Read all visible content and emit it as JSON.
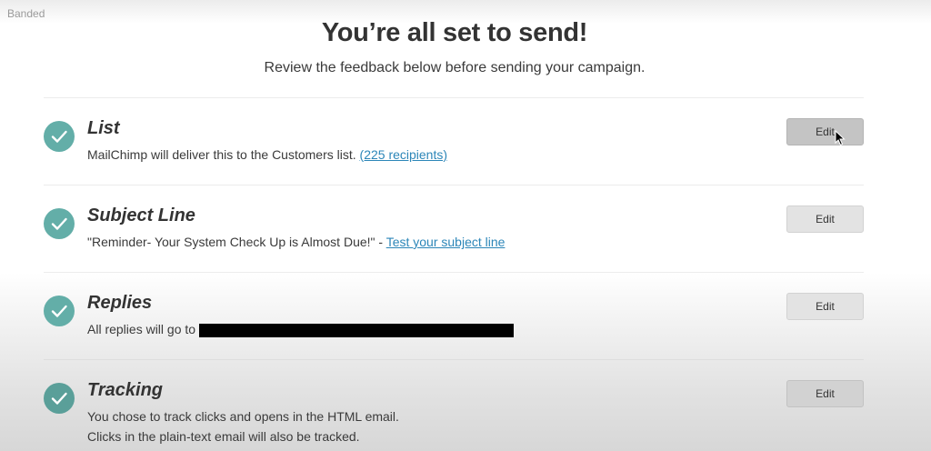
{
  "watermark": "Banded",
  "header": {
    "title": "You’re all set to send!",
    "subtitle": "Review the feedback below before sending your campaign."
  },
  "sections": [
    {
      "title": "List",
      "text": "MailChimp will deliver this to the Customers list.",
      "link": "(225 recipients)",
      "edit_label": "Edit"
    },
    {
      "title": "Subject Line",
      "text": "\"Reminder- Your System Check Up is Almost Due!\" -",
      "link": "Test your subject line",
      "edit_label": "Edit"
    },
    {
      "title": "Replies",
      "text": "All replies will go to",
      "edit_label": "Edit"
    },
    {
      "title": "Tracking",
      "text": "You chose to track clicks and opens in the HTML email.",
      "text2": "Clicks in the plain-text email will also be tracked.",
      "edit_label": "Edit"
    }
  ],
  "icons": {
    "check": "check-icon",
    "cursor": "mouse-pointer-icon"
  },
  "colors": {
    "check_circle": "#63aea8",
    "link": "#2c86b8",
    "edit_button": "#e3e3e3",
    "edit_button_hover": "#c4c4c4"
  }
}
